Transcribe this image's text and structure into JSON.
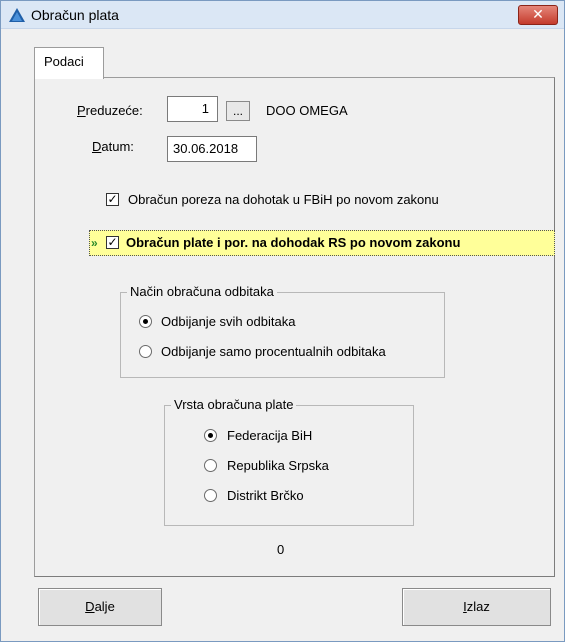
{
  "window": {
    "title": "Obračun plata",
    "close_label": "✕"
  },
  "tabs": [
    {
      "label": "Podaci",
      "active": true
    }
  ],
  "form": {
    "company_label": "Preduzeće:",
    "company_label_hotkey": "P",
    "company_label_rest": "reduzeće:",
    "company_id": "1",
    "browse_label": "...",
    "company_name": "DOO OMEGA",
    "date_label_hotkey": "D",
    "date_label_rest": "atum:",
    "date_value": "30.06.2018"
  },
  "checkboxes": [
    {
      "label": "Obračun poreza na dohotak u FBiH po novom zakonu",
      "checked": true
    },
    {
      "label": "Obračun plate i por. na dohodak RS po novom zakonu",
      "checked": true,
      "focused": true
    }
  ],
  "focus_marker": "»",
  "deduction_group": {
    "title": "Način obračuna odbitaka",
    "options": [
      {
        "label": "Odbijanje svih odbitaka",
        "selected": true
      },
      {
        "label": "Odbijanje samo procentualnih odbitaka",
        "selected": false
      }
    ]
  },
  "salary_type_group": {
    "title": "Vrsta obračuna plate",
    "options": [
      {
        "label": "Federacija BiH",
        "selected": true
      },
      {
        "label": "Republika Srpska",
        "selected": false
      },
      {
        "label": "Distrikt Brčko",
        "selected": false
      }
    ]
  },
  "counter_value": "0",
  "buttons": {
    "next_hotkey": "D",
    "next_rest": "alje",
    "exit_hotkey": "I",
    "exit_rest": "zlaz"
  },
  "colors": {
    "highlight": "#ffff99",
    "close_button": "#c43b2c",
    "titlebar": "#dbe7f5"
  },
  "icons": {
    "app": "triangle-app-icon",
    "close": "close-icon"
  }
}
